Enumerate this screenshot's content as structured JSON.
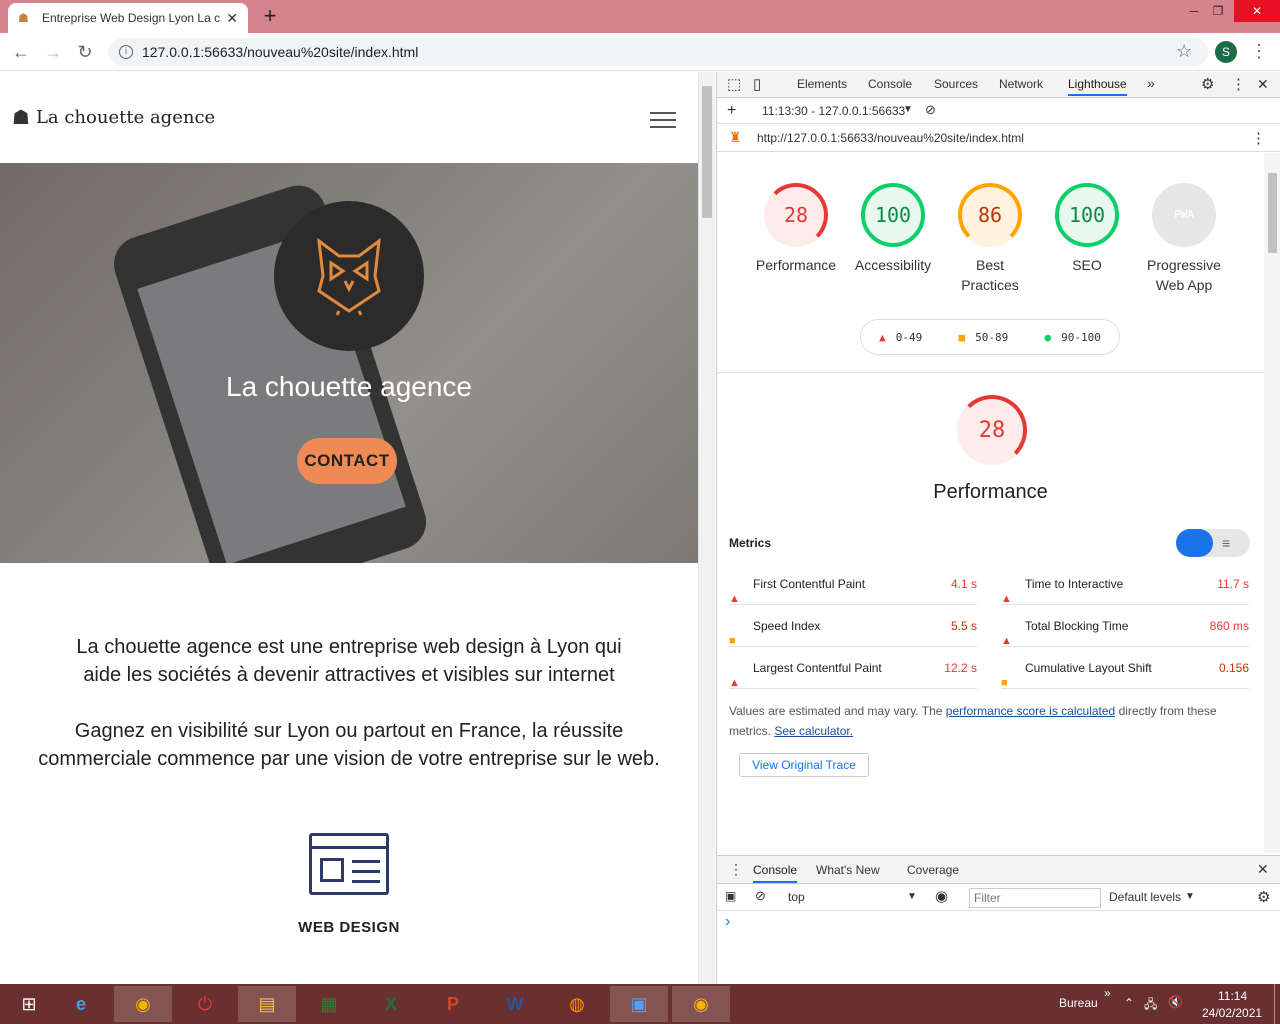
{
  "browser": {
    "tab_title": "Entreprise Web Design Lyon La c",
    "url": "127.0.0.1:56633/nouveau%20site/index.html",
    "avatar_initial": "S"
  },
  "site": {
    "brand": "La chouette agence",
    "hero_title": "La chouette agence",
    "contact_label": "CONTACT",
    "intro_p1_line1": "La chouette agence est une entreprise web design à Lyon qui",
    "intro_p1_line2": "aide les sociétés à devenir attractives et visibles sur internet",
    "intro_p2_line1": "Gagnez en visibilité sur Lyon ou partout en France, la réussite",
    "intro_p2_line2": "commerciale commence par une vision de votre entreprise sur le web.",
    "service_label": "WEB DESIGN"
  },
  "devtools": {
    "tabs": [
      "Elements",
      "Console",
      "Sources",
      "Network",
      "Lighthouse"
    ],
    "more": "»",
    "report_select": "11:13:30 - 127.0.0.1:56633",
    "report_url": "http://127.0.0.1:56633/nouveau%20site/index.html",
    "scores": [
      {
        "value": "28",
        "label": "Performance"
      },
      {
        "value": "100",
        "label": "Accessibility"
      },
      {
        "value": "86",
        "label_line1": "Best",
        "label_line2": "Practices"
      },
      {
        "value": "100",
        "label": "SEO"
      },
      {
        "value": "PWA",
        "label_line1": "Progressive",
        "label_line2": "Web App"
      }
    ],
    "legend": [
      "0-49",
      "50-89",
      "90-100"
    ],
    "perf_score": "28",
    "perf_title": "Performance",
    "metrics_heading": "Metrics",
    "metrics": [
      {
        "name": "First Contentful Paint",
        "value": "4.1 s",
        "status": "fail"
      },
      {
        "name": "Time to Interactive",
        "value": "11.7 s",
        "status": "fail"
      },
      {
        "name": "Speed Index",
        "value": "5.5 s",
        "status": "average"
      },
      {
        "name": "Total Blocking Time",
        "value": "860 ms",
        "status": "fail"
      },
      {
        "name": "Largest Contentful Paint",
        "value": "12.2 s",
        "status": "fail"
      },
      {
        "name": "Cumulative Layout Shift",
        "value": "0.156",
        "status": "average"
      }
    ],
    "note_prefix": "Values are estimated and may vary. The",
    "note_link1": "performance score is calculated",
    "note_mid": "directly from these",
    "note_line2": "metrics.",
    "note_link2": "See calculator.",
    "view_trace": "View Original Trace",
    "drawer_tabs": [
      "Console",
      "What's New",
      "Coverage"
    ],
    "context": "top",
    "filter_placeholder": "Filter",
    "levels": "Default levels",
    "prompt": "›"
  },
  "colors": {
    "fail": "#e53935",
    "average": "#ffa400",
    "pass": "#0cce6b"
  },
  "taskbar": {
    "tray_label": "Bureau",
    "time": "11:14",
    "date": "24/02/2021"
  }
}
